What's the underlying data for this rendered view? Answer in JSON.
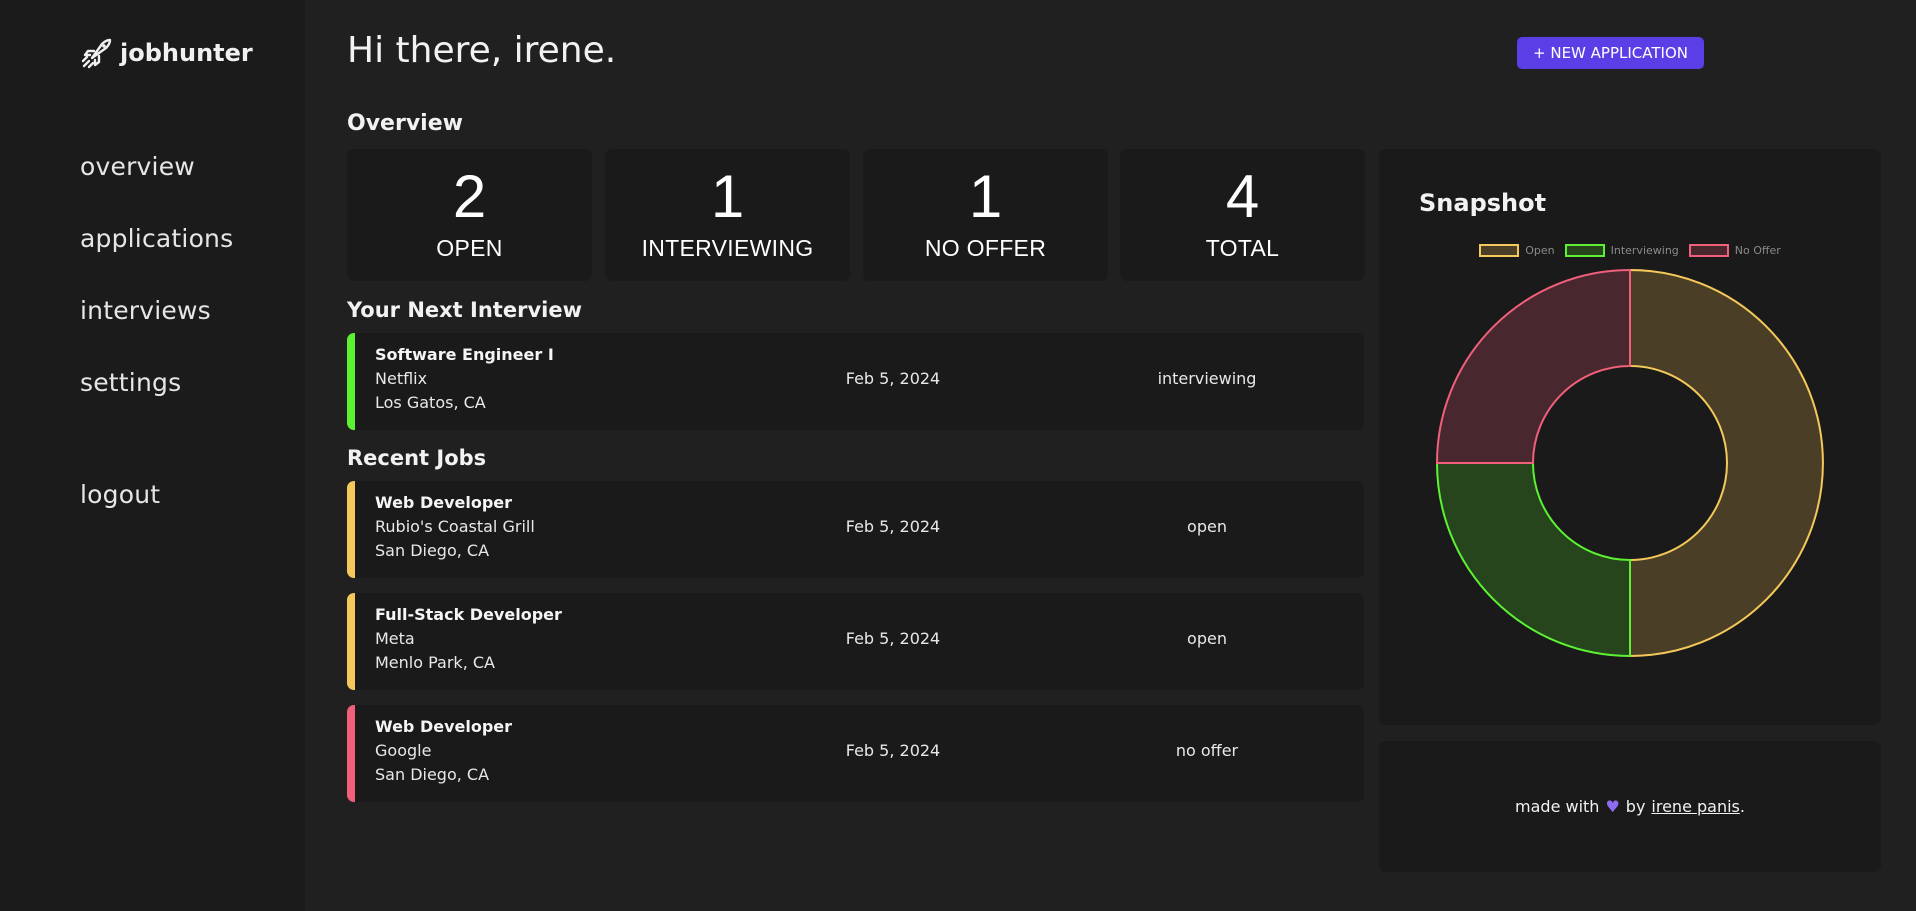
{
  "brand": {
    "name": "jobhunter",
    "icon": "rocket-icon"
  },
  "nav": {
    "overview": "overview",
    "applications": "applications",
    "interviews": "interviews",
    "settings": "settings",
    "logout": "logout"
  },
  "header": {
    "greeting": "Hi there, irene.",
    "new_application_label": "+ NEW APPLICATION"
  },
  "overview": {
    "title": "Overview",
    "stats": [
      {
        "value": "2",
        "label": "OPEN"
      },
      {
        "value": "1",
        "label": "INTERVIEWING"
      },
      {
        "value": "1",
        "label": "NO OFFER"
      },
      {
        "value": "4",
        "label": "TOTAL"
      }
    ]
  },
  "next_interview": {
    "title": "Your Next Interview",
    "job": {
      "title": "Software Engineer I",
      "company": "Netflix",
      "location": "Los Gatos, CA",
      "date": "Feb 5, 2024",
      "status": "interviewing",
      "accent": "#5cf233"
    }
  },
  "recent_jobs": {
    "title": "Recent Jobs",
    "items": [
      {
        "title": "Web Developer",
        "company": "Rubio's Coastal Grill",
        "location": "San Diego, CA",
        "date": "Feb 5, 2024",
        "status": "open",
        "accent": "#f5c85a"
      },
      {
        "title": "Full-Stack Developer",
        "company": "Meta",
        "location": "Menlo Park, CA",
        "date": "Feb 5, 2024",
        "status": "open",
        "accent": "#f5c85a"
      },
      {
        "title": "Web Developer",
        "company": "Google",
        "location": "San Diego, CA",
        "date": "Feb 5, 2024",
        "status": "no offer",
        "accent": "#f0607a"
      }
    ]
  },
  "snapshot": {
    "title": "Snapshot"
  },
  "chart_data": {
    "type": "pie",
    "variant": "doughnut",
    "title": "",
    "legend_position": "top",
    "series": [
      {
        "name": "Open",
        "value": 2,
        "border": "#f5c85a",
        "fill": "#4a3f26"
      },
      {
        "name": "Interviewing",
        "value": 1,
        "border": "#5cf233",
        "fill": "#26451d"
      },
      {
        "name": "No Offer",
        "value": 1,
        "border": "#f0607a",
        "fill": "#48272f"
      }
    ]
  },
  "footer": {
    "made_with": "made with",
    "by": "by",
    "author": "irene panis",
    "period": ".",
    "heart_icon": "heart-icon",
    "heart_color": "#8e6cf0"
  },
  "colors": {
    "background": "#202020",
    "sidebar": "#1b1b1b",
    "card": "#1a1a1a",
    "accent_button": "#5b3ee6"
  }
}
